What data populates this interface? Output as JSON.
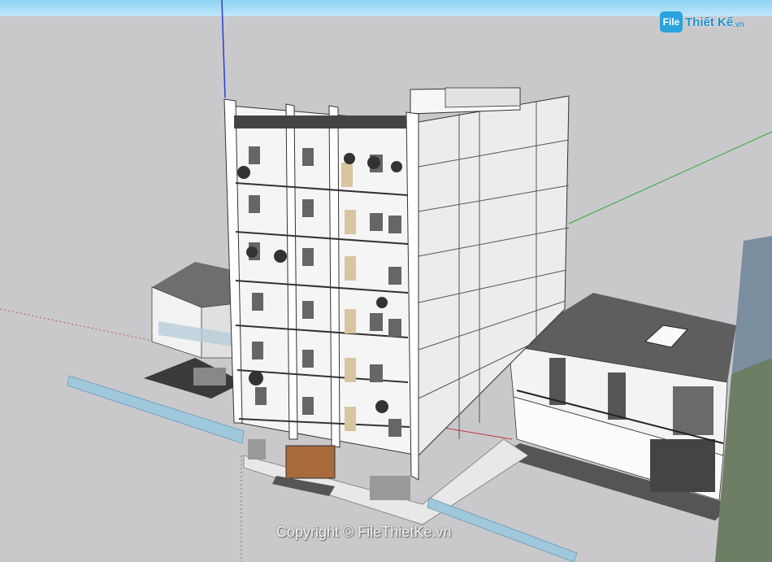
{
  "brand": {
    "logo_mark": "File",
    "logo_word": "Thiết Kế",
    "logo_tld": ".vn"
  },
  "watermark": {
    "copyright": "Copyright © FileThietKe.vn"
  },
  "scene": {
    "axis_colors": {
      "blue": "#2b3bd6",
      "green": "#2ea83a",
      "red": "#c23a3a"
    },
    "sky_color": "#a6dcf6",
    "ground_color": "#c9c9cc"
  }
}
